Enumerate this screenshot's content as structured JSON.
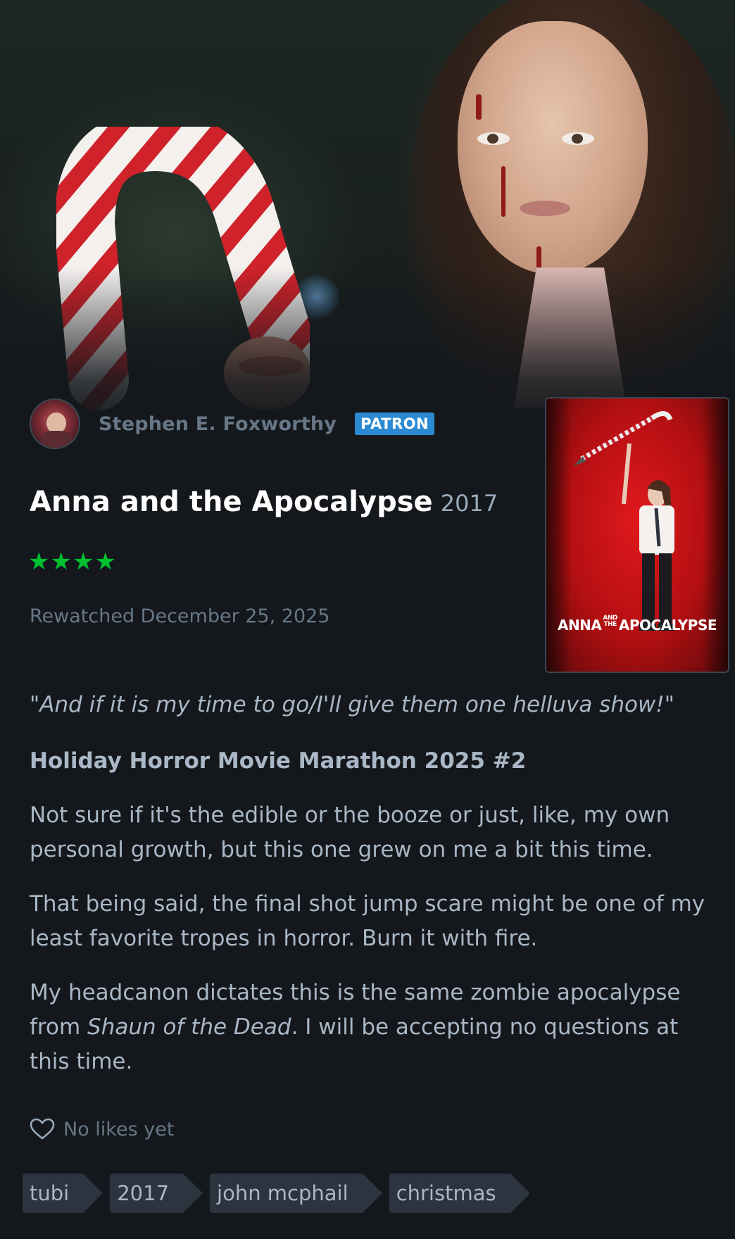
{
  "user": {
    "name": "Stephen E. Foxworthy",
    "badge": "PATRON"
  },
  "film": {
    "title": "Anna and the Apocalypse",
    "year": "2017",
    "rating_stars": 4,
    "rating_display": "★★★★",
    "poster_title_left": "ANNA",
    "poster_title_small_top": "AND",
    "poster_title_small_bottom": "THE",
    "poster_title_right": "APOCALYPSE"
  },
  "watched": "Rewatched December 25, 2025",
  "review": {
    "quote": "\"And if it is my time to go/I'll give them one helluva show!\"",
    "heading": "Holiday Horror Movie Marathon 2025 #2",
    "para1": "Not sure if it's the edible or the booze or just, like, my own personal growth, but this one grew on me a bit this time.",
    "para2": "That being said, the final shot jump scare might be one of my least favorite tropes in horror. Burn it with fire.",
    "para3_before": "My headcanon dictates this is the same zombie apocalypse from ",
    "para3_italic": "Shaun of the Dead",
    "para3_after": ". I will be accepting no questions at this time."
  },
  "likes": {
    "text": "No likes yet",
    "icon": "heart-icon"
  },
  "tags": [
    "tubi",
    "2017",
    "john mcphail",
    "christmas"
  ],
  "colors": {
    "background": "#14181c",
    "star_green": "#00c030",
    "patron_blue": "#2b8ad1",
    "tag_bg": "#2c3440",
    "muted_text": "#677787",
    "body_text": "#a9b7c6"
  }
}
